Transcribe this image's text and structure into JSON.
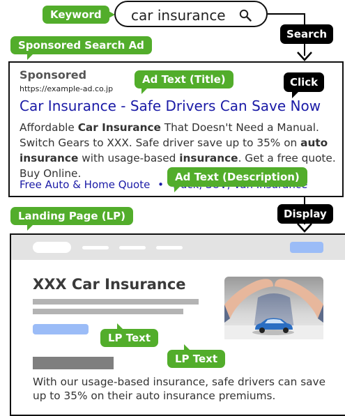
{
  "search": {
    "keyword_label": "Keyword",
    "query": "car insurance",
    "action_label": "Search"
  },
  "ad": {
    "section_label": "Sponsored Search Ad",
    "sponsored": "Sponsored",
    "url": "https://example-ad.co.jp",
    "title": "Car Insurance - Safe Drivers Can Save Now",
    "title_label": "Ad Text (Title)",
    "click_label": "Click",
    "description_parts": [
      {
        "t": "Affordable ",
        "b": false
      },
      {
        "t": "Car Insurance",
        "b": true
      },
      {
        "t": " That Doesn't Need a Manual. Switch Gears to XXX. Safe driver save up to 35% on ",
        "b": false
      },
      {
        "t": "auto insurance",
        "b": true
      },
      {
        "t": " with usage-based ",
        "b": false
      },
      {
        "t": "insurance",
        "b": true
      },
      {
        "t": ". Get a free quote. Buy Online.",
        "b": false
      }
    ],
    "description_label": "Ad Text (Description)",
    "sitelinks": [
      "Free Auto & Home Quote",
      "Truck, SUV, Van Insurance"
    ],
    "sitelink_separator": "•"
  },
  "lp": {
    "section_label": "Landing Page (LP)",
    "display_label": "Display",
    "title": "XXX Car Insurance",
    "text_label_1": "LP Text",
    "text_label_2": "LP Text",
    "body": "With our usage-based insurance, safe drivers can save up to 35% on their auto insurance premiums."
  },
  "colors": {
    "tag_green": "#52ad2b",
    "ad_link_blue": "#1a1aa6",
    "lp_button_blue": "#9bbcf7",
    "black_label": "#000000"
  }
}
